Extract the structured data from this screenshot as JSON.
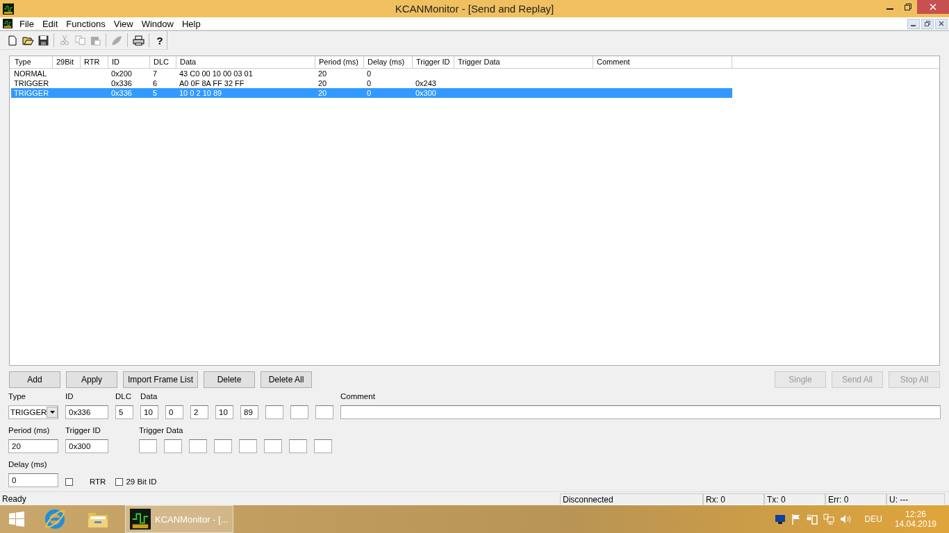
{
  "window": {
    "title": "KCANMonitor - [Send and Replay]"
  },
  "menu": [
    "File",
    "Edit",
    "Functions",
    "View",
    "Window",
    "Help"
  ],
  "toolbar": [
    {
      "kind": "new",
      "disabled": false
    },
    {
      "kind": "open",
      "disabled": false
    },
    {
      "kind": "save",
      "disabled": false
    },
    {
      "kind": "sep"
    },
    {
      "kind": "cut",
      "disabled": true
    },
    {
      "kind": "copy",
      "disabled": true
    },
    {
      "kind": "paste",
      "disabled": true
    },
    {
      "kind": "sep"
    },
    {
      "kind": "leaf",
      "disabled": true
    },
    {
      "kind": "sep"
    },
    {
      "kind": "print",
      "disabled": false
    },
    {
      "kind": "sep"
    },
    {
      "kind": "help",
      "label": "?",
      "disabled": false
    }
  ],
  "table": {
    "columns": [
      "Type",
      "29Bit",
      "RTR",
      "ID",
      "DLC",
      "Data",
      "Period (ms)",
      "Delay (ms)",
      "Trigger ID",
      "Trigger Data",
      "Comment"
    ],
    "rows": [
      {
        "selected": false,
        "cells": {
          "Type": "NORMAL",
          "ID": "0x200",
          "DLC": "7",
          "Data": "43 C0 00 10 00 03 01",
          "Period": "20",
          "Delay": "0"
        }
      },
      {
        "selected": false,
        "cells": {
          "Type": "TRIGGER",
          "ID": "0x336",
          "DLC": "6",
          "Data": "A0 0F 8A FF 32 FF",
          "Period": "20",
          "Delay": "0",
          "TriggerID": "0x243"
        }
      },
      {
        "selected": true,
        "cells": {
          "Type": "TRIGGER",
          "ID": "0x336",
          "DLC": "5",
          "Data": "10 0 2 10 89",
          "Period": "20",
          "Delay": "0",
          "TriggerID": "0x300"
        }
      }
    ]
  },
  "buttons_left": [
    {
      "label": "Add",
      "disabled": false
    },
    {
      "label": "Apply",
      "disabled": false
    },
    {
      "label": "Import Frame List",
      "disabled": false
    },
    {
      "label": "Delete",
      "disabled": false
    },
    {
      "label": "Delete All",
      "disabled": false
    }
  ],
  "buttons_right": [
    {
      "label": "Single",
      "disabled": true
    },
    {
      "label": "Send All",
      "disabled": true
    },
    {
      "label": "Stop All",
      "disabled": true
    }
  ],
  "form": {
    "type": {
      "label": "Type",
      "value": "TRIGGER"
    },
    "id": {
      "label": "ID",
      "value": "0x336"
    },
    "dlc": {
      "label": "DLC",
      "value": "5"
    },
    "data": {
      "label": "Data",
      "values": [
        "10",
        "0",
        "2",
        "10",
        "89"
      ]
    },
    "comment": {
      "label": "Comment"
    },
    "period": {
      "label": "Period (ms)",
      "value": "20"
    },
    "trigger_id": {
      "label": "Trigger ID",
      "value": "0x300"
    },
    "trigger_data": {
      "label": "Trigger Data"
    },
    "delay": {
      "label": "Delay (ms)",
      "value": "0"
    },
    "rtr": {
      "label": "RTR",
      "checked": false
    },
    "bit29": {
      "label": "29 Bit ID",
      "checked": false
    }
  },
  "status_bar": {
    "message": "Ready",
    "connection": "Disconnected",
    "rx": "Rx: 0",
    "tx": "Tx: 0",
    "err": "Err: 0",
    "u": "U:  ---"
  },
  "taskbar": {
    "app": "KCANMonitor - [...",
    "language": "DEU",
    "time": "12:26",
    "date": "14.04.2019"
  }
}
